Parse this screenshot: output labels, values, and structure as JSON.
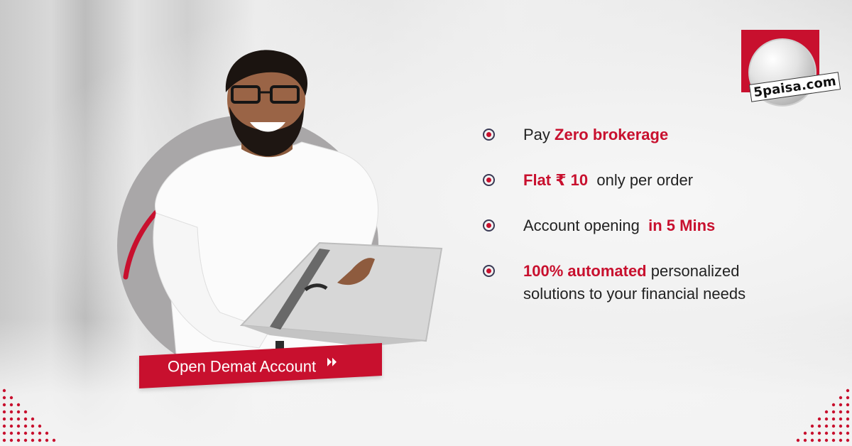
{
  "brand": {
    "logo_text": "5paisa.com",
    "accent_color": "#c8102e"
  },
  "cta": {
    "label": "Open Demat Account",
    "icon": "double-chevron-right-icon"
  },
  "features": [
    {
      "pre": "Pay ",
      "accent": "Zero brokerage",
      "post": ""
    },
    {
      "pre": "",
      "accent": "Flat ₹ 10",
      "post": "  only per order"
    },
    {
      "pre": "Account opening ",
      "accent": " in 5 Mins",
      "post": ""
    },
    {
      "pre": "",
      "accent": "100% automated",
      "post": " personalized",
      "line2": "solutions to your financial needs"
    }
  ]
}
